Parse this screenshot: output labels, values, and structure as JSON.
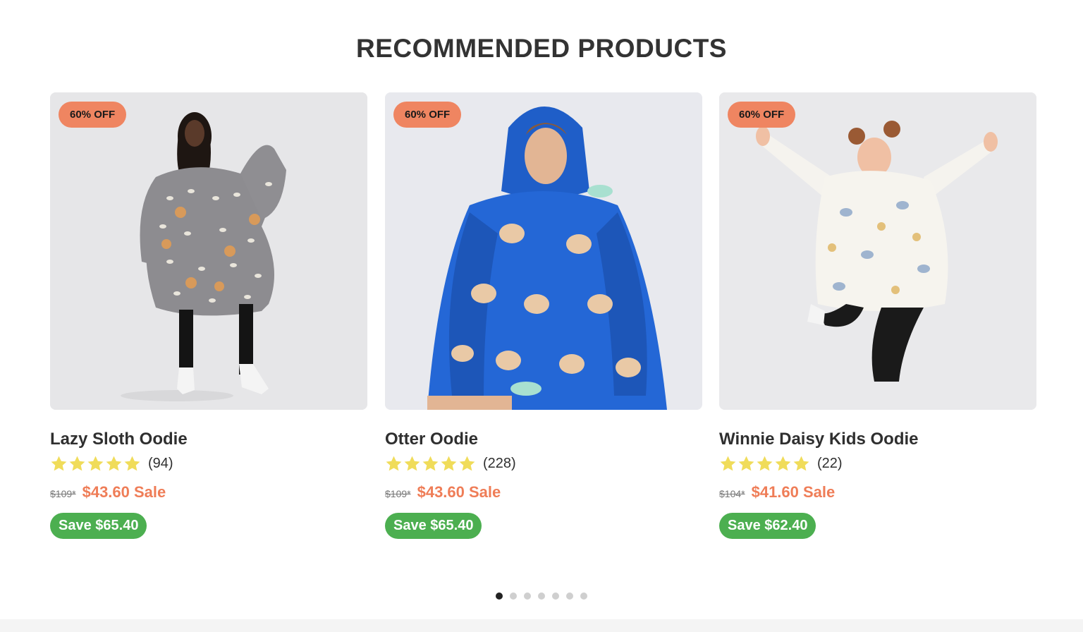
{
  "section": {
    "title": "RECOMMENDED PRODUCTS"
  },
  "colors": {
    "badge_bg": "#ef8561",
    "sale_price": "#ef7d57",
    "save_bg": "#4caf50",
    "star": "#f0dc5a",
    "dot_active": "#222222",
    "dot_inactive": "#cfcfcf"
  },
  "products": [
    {
      "badge": "60% OFF",
      "name": "Lazy Sloth Oodie",
      "rating_stars": 5,
      "review_count": "(94)",
      "old_price": "$109*",
      "sale_price": "$43.60 Sale",
      "save": "Save $65.40",
      "image": "person-in-grey-sloth-print-oodie"
    },
    {
      "badge": "60% OFF",
      "name": "Otter Oodie",
      "rating_stars": 5,
      "review_count": "(228)",
      "old_price": "$109*",
      "sale_price": "$43.60 Sale",
      "save": "Save $65.40",
      "image": "person-in-blue-otter-print-oodie"
    },
    {
      "badge": "60% OFF",
      "name": "Winnie Daisy Kids Oodie",
      "rating_stars": 5,
      "review_count": "(22)",
      "old_price": "$104*",
      "sale_price": "$41.60 Sale",
      "save": "Save $62.40",
      "image": "child-jumping-in-white-winnie-print-oodie"
    }
  ],
  "carousel": {
    "page_count": 7,
    "active_page": 1
  }
}
